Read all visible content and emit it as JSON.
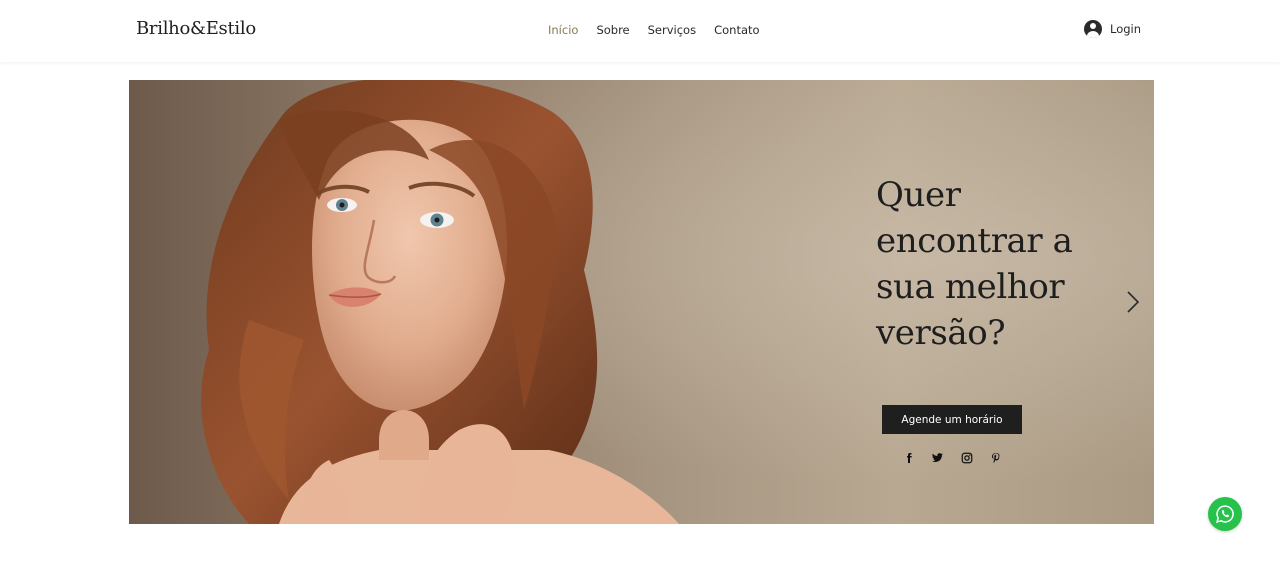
{
  "header": {
    "brand": "Brilho&Estilo",
    "nav": [
      {
        "label": "Início",
        "active": true
      },
      {
        "label": "Sobre",
        "active": false
      },
      {
        "label": "Serviços",
        "active": false
      },
      {
        "label": "Contato",
        "active": false
      }
    ],
    "login_label": "Login"
  },
  "hero": {
    "headline_lines": [
      "Quer",
      "encontrar a",
      "sua melhor",
      "versão?"
    ],
    "cta_label": "Agende um horário",
    "social_icons": [
      "facebook-icon",
      "twitter-icon",
      "instagram-icon",
      "pinterest-icon"
    ]
  },
  "colors": {
    "accent_active_nav": "#8a7a4f",
    "cta_bg": "#1f1f1f",
    "whatsapp": "#27c24c"
  }
}
